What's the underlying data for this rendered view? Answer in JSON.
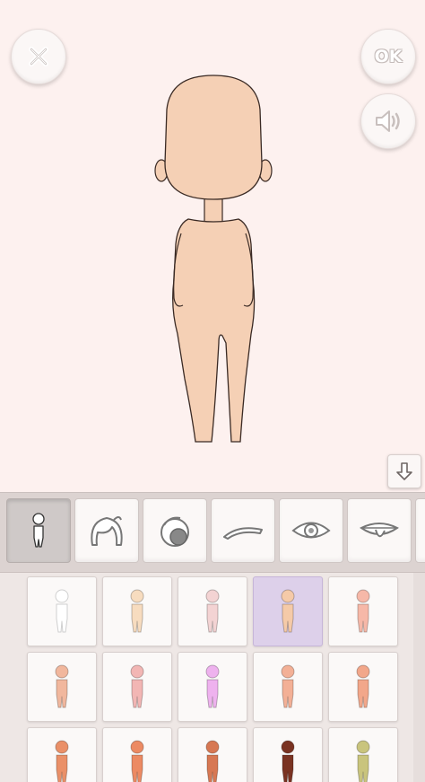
{
  "top_buttons": {
    "close_icon": "close-x-icon",
    "ok_label": "OK",
    "sound_icon": "speaker-icon"
  },
  "colors": {
    "background": "#fdf1ef",
    "skin_preview": "#f5d0b5",
    "selected_cell": "#ddd0ea"
  },
  "collapse_button": {
    "icon": "arrow-down-icon"
  },
  "tabs": [
    {
      "name": "body",
      "icon": "body-icon",
      "active": true
    },
    {
      "name": "hair-front",
      "icon": "hair-icon",
      "active": false
    },
    {
      "name": "hair-back",
      "icon": "hair-back-icon",
      "active": false
    },
    {
      "name": "eyebrows",
      "icon": "eyebrow-icon",
      "active": false
    },
    {
      "name": "eyes",
      "icon": "eye-icon",
      "active": false
    },
    {
      "name": "mouth",
      "icon": "mouth-icon",
      "active": false
    }
  ],
  "skin_options": [
    {
      "color": "#ffffff",
      "selected": false
    },
    {
      "color": "#f7dcbf",
      "selected": false
    },
    {
      "color": "#f3d3d3",
      "selected": false
    },
    {
      "color": "#f5caa8",
      "selected": true
    },
    {
      "color": "#f6b8a8",
      "selected": false
    },
    {
      "color": "#f1b79d",
      "selected": false
    },
    {
      "color": "#f2b6b4",
      "selected": false
    },
    {
      "color": "#eeb2ee",
      "selected": false
    },
    {
      "color": "#f3b096",
      "selected": false
    },
    {
      "color": "#f2a78a",
      "selected": false
    },
    {
      "color": "#ea9068",
      "selected": false
    },
    {
      "color": "#ec8a63",
      "selected": false
    },
    {
      "color": "#d77853",
      "selected": false
    },
    {
      "color": "#7a3322",
      "selected": false
    },
    {
      "color": "#c9c47d",
      "selected": false
    }
  ]
}
